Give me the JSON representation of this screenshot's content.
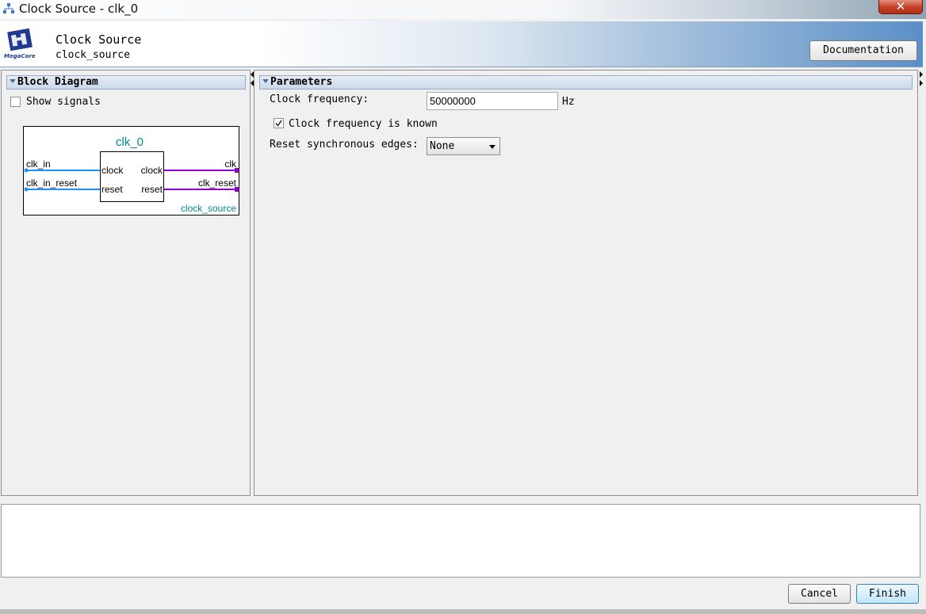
{
  "window": {
    "title": "Clock Source - clk_0",
    "close_symbol": "✕"
  },
  "header": {
    "title": "Clock Source",
    "subtitle": "clock_source",
    "documentation_label": "Documentation",
    "logo_text": "MegaCore"
  },
  "block_diagram": {
    "section_title": "Block Diagram",
    "show_signals_label": "Show signals",
    "show_signals_checked": false,
    "instance_name": "clk_0",
    "component_name": "clock_source",
    "inputs": [
      {
        "name": "clk_in",
        "port": "clock"
      },
      {
        "name": "clk_in_reset",
        "port": "reset"
      }
    ],
    "outputs": [
      {
        "name": "clk",
        "port": "clock"
      },
      {
        "name": "clk_reset",
        "port": "reset"
      }
    ],
    "colors": {
      "input_wire": "#1e90ff",
      "output_wire": "#9400d3",
      "instance_label": "#008b8b"
    }
  },
  "parameters": {
    "section_title": "Parameters",
    "clock_frequency_label": "Clock frequency:",
    "clock_frequency_value": "50000000",
    "clock_frequency_unit": "Hz",
    "known_label": "Clock frequency is known",
    "known_checked": true,
    "reset_edges_label": "Reset synchronous edges:",
    "reset_edges_value": "None"
  },
  "footer": {
    "cancel_label": "Cancel",
    "finish_label": "Finish"
  }
}
